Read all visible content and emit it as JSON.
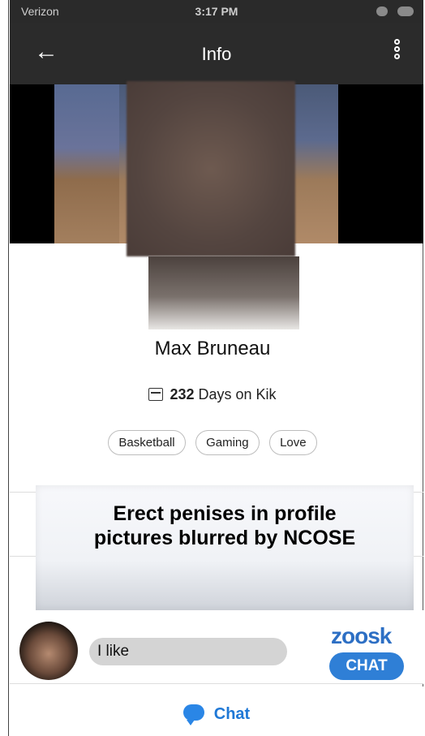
{
  "status": {
    "carrier": "Verizon",
    "time": "3:17 PM"
  },
  "nav": {
    "title": "Info",
    "back_icon": "←"
  },
  "profile": {
    "name": "Max Bruneau",
    "days_count": "232",
    "days_label": "Days on Kik",
    "tags": [
      "Basketball",
      "Gaming",
      "Love"
    ]
  },
  "banner": {
    "line1": "Erect penises in profile",
    "line2": "pictures blurred by NCOSE"
  },
  "ad": {
    "message": "I like",
    "brand": "zoosk",
    "button": "CHAT"
  },
  "bottom": {
    "chat_label": "Chat"
  },
  "colors": {
    "accent": "#2f7fd6",
    "navbar": "#2b2b2b"
  }
}
